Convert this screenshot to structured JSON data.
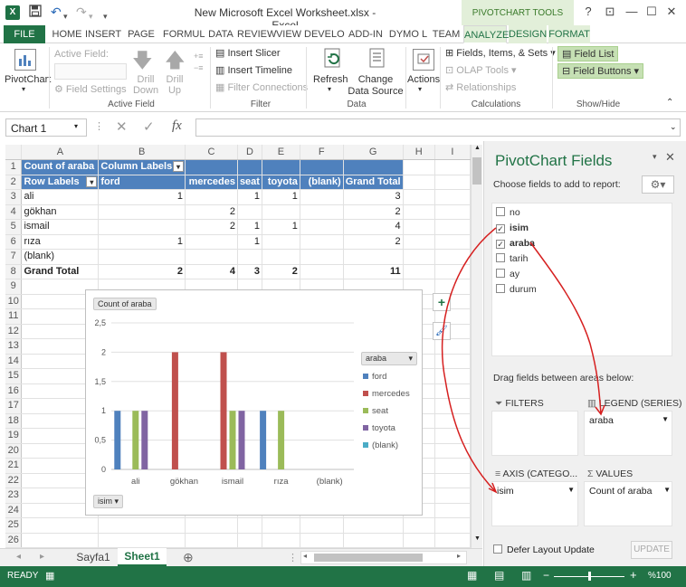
{
  "titlebar": {
    "title": "New Microsoft Excel Worksheet.xlsx - Excel",
    "context_tools": "PIVOTCHART TOOLS",
    "help": "?",
    "restore_ribbon": "⊡",
    "minimize": "—",
    "maximize": "☐",
    "close": "✕",
    "qat_save": "💾",
    "qat_undo": "↶",
    "qat_redo": "↷",
    "qat_customize": "▾"
  },
  "tabs": {
    "file": "FILE",
    "home": "HOME",
    "insert": "INSERT",
    "page_layout": "PAGE LA",
    "formulas": "FORMUL",
    "data": "DATA",
    "review": "REVIEW",
    "view": "VIEW",
    "developer": "DEVELO",
    "addin": "ADD-IN",
    "dymo": "DYMO L",
    "team": "TEAM",
    "analyze": "ANALYZE",
    "design": "DESIGN",
    "format": "FORMAT"
  },
  "ribbon": {
    "pivotchart": "PivotChart",
    "active_field_label": "Active Field:",
    "field_settings": "Field Settings",
    "drill_down": "Drill Down",
    "drill_up": "Drill Up",
    "group_active_field": "Active Field",
    "insert_slicer": "Insert Slicer",
    "insert_timeline": "Insert Timeline",
    "filter_connections": "Filter Connections",
    "group_filter": "Filter",
    "refresh": "Refresh",
    "change_data_source": "Change Data Source",
    "group_data": "Data",
    "actions": "Actions",
    "fields_items_sets": "Fields, Items, & Sets",
    "olap_tools": "OLAP Tools",
    "relationships": "Relationships",
    "group_calculations": "Calculations",
    "field_list": "Field List",
    "field_buttons": "Field Buttons",
    "group_showhide": "Show/Hide"
  },
  "formula_bar": {
    "name_box": "Chart 1",
    "fx": "fx",
    "cancel": "✕",
    "enter": "✓",
    "content": ""
  },
  "sheet": {
    "columns": [
      "A",
      "B",
      "C",
      "D",
      "E",
      "F",
      "G",
      "H",
      "I"
    ],
    "rows": [
      {
        "n": "1",
        "cells": [
          "Count of araba",
          "Column Labels",
          "",
          "",
          "",
          "",
          "",
          "",
          ""
        ]
      },
      {
        "n": "2",
        "cells": [
          "Row Labels",
          "ford",
          "mercedes",
          "seat",
          "toyota",
          "(blank)",
          "Grand Total",
          "",
          ""
        ]
      },
      {
        "n": "3",
        "cells": [
          "ali",
          "1",
          "",
          "1",
          "1",
          "",
          "3",
          "",
          ""
        ]
      },
      {
        "n": "4",
        "cells": [
          "gökhan",
          "",
          "2",
          "",
          "",
          "",
          "2",
          "",
          ""
        ]
      },
      {
        "n": "5",
        "cells": [
          "ismail",
          "",
          "2",
          "1",
          "1",
          "",
          "4",
          "",
          ""
        ]
      },
      {
        "n": "6",
        "cells": [
          "rıza",
          "1",
          "",
          "1",
          "",
          "",
          "2",
          "",
          ""
        ]
      },
      {
        "n": "7",
        "cells": [
          "(blank)",
          "",
          "",
          "",
          "",
          "",
          "",
          "",
          ""
        ]
      },
      {
        "n": "8",
        "cells": [
          "Grand Total",
          "2",
          "4",
          "3",
          "2",
          "",
          "11",
          "",
          ""
        ]
      },
      {
        "n": "9",
        "cells": []
      },
      {
        "n": "10",
        "cells": []
      },
      {
        "n": "11",
        "cells": []
      },
      {
        "n": "12",
        "cells": []
      },
      {
        "n": "13",
        "cells": []
      },
      {
        "n": "14",
        "cells": []
      },
      {
        "n": "15",
        "cells": []
      },
      {
        "n": "16",
        "cells": []
      },
      {
        "n": "17",
        "cells": []
      },
      {
        "n": "18",
        "cells": []
      },
      {
        "n": "19",
        "cells": []
      },
      {
        "n": "20",
        "cells": []
      },
      {
        "n": "21",
        "cells": []
      },
      {
        "n": "22",
        "cells": []
      },
      {
        "n": "23",
        "cells": []
      },
      {
        "n": "24",
        "cells": []
      },
      {
        "n": "25",
        "cells": []
      },
      {
        "n": "26",
        "cells": []
      }
    ],
    "sheet_tabs": [
      "Sayfa1",
      "Sheet1"
    ],
    "active_sheet": "Sheet1",
    "add_sheet": "⊕"
  },
  "chart_data": {
    "type": "bar",
    "categories": [
      "ali",
      "gökhan",
      "ismail",
      "rıza",
      "(blank)"
    ],
    "series": [
      {
        "name": "ford",
        "color": "#4f81bd",
        "values": [
          1,
          0,
          0,
          1,
          0
        ]
      },
      {
        "name": "mercedes",
        "color": "#c0504d",
        "values": [
          0,
          2,
          2,
          0,
          0
        ]
      },
      {
        "name": "seat",
        "color": "#9bbb59",
        "values": [
          1,
          0,
          1,
          1,
          0
        ]
      },
      {
        "name": "toyota",
        "color": "#8064a2",
        "values": [
          1,
          0,
          1,
          0,
          0
        ]
      },
      {
        "name": "(blank)",
        "color": "#4bacc6",
        "values": [
          0,
          0,
          0,
          0,
          0
        ]
      }
    ],
    "value_button": "Count of araba",
    "axis_button": "isim",
    "legend_button": "araba",
    "yticks": [
      "0",
      "0,5",
      "1",
      "1,5",
      "2",
      "2,5"
    ],
    "ylim": [
      0,
      2.5
    ],
    "grid": true,
    "legend_position": "right"
  },
  "pane": {
    "title": "PivotChart Fields",
    "choose_fields": "Choose fields to add to report:",
    "fields": [
      {
        "name": "no",
        "checked": false
      },
      {
        "name": "isim",
        "checked": true
      },
      {
        "name": "araba",
        "checked": true
      },
      {
        "name": "tarih",
        "checked": false
      },
      {
        "name": "ay",
        "checked": false
      },
      {
        "name": "durum",
        "checked": false
      }
    ],
    "drag_label": "Drag fields between areas below:",
    "filters": "FILTERS",
    "legend_series": "LEGEND (SERIES)",
    "legend_item": "araba",
    "axis": "AXIS (CATEGO...",
    "axis_item": "isim",
    "values": "VALUES",
    "values_item": "Count of araba",
    "defer": "Defer Layout Update",
    "update": "UPDATE"
  },
  "status": {
    "ready": "READY",
    "zoom": "%100"
  }
}
